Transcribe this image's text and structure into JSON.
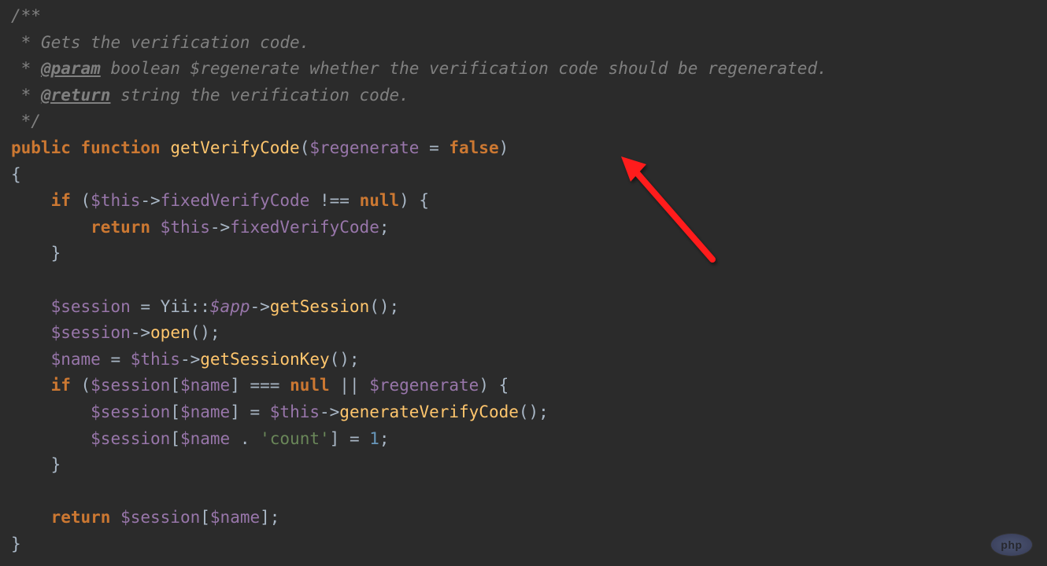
{
  "code": {
    "line1_comment_open": "/**",
    "line2_prefix": " * ",
    "line2_text": "Gets the verification code.",
    "line3_prefix": " * ",
    "line3_tag": "@param",
    "line3_text": " boolean $regenerate whether the verification code should be regenerated.",
    "line4_prefix": " * ",
    "line4_tag": "@return",
    "line4_text": " string the verification code.",
    "line5_comment_close": " */",
    "line6_public": "public",
    "line6_function": "function",
    "line6_funcname": "getVerifyCode",
    "line6_open_paren": "(",
    "line6_param": "$regenerate",
    "line6_eq": " = ",
    "line6_false": "false",
    "line6_close_paren": ")",
    "line7_brace": "{",
    "line8_if": "if",
    "line8_open": " (",
    "line8_this": "$this",
    "line8_arrow": "->",
    "line8_prop": "fixedVerifyCode",
    "line8_neq": " !== ",
    "line8_null": "null",
    "line8_close": ") {",
    "line9_return": "return",
    "line9_this": "$this",
    "line9_arrow": "->",
    "line9_prop": "fixedVerifyCode",
    "line9_semi": ";",
    "line10_brace": "}",
    "line12_var": "$session",
    "line12_eq": " = ",
    "line12_class": "Yii",
    "line12_scope": "::",
    "line12_static": "$app",
    "line12_arrow": "->",
    "line12_method": "getSession",
    "line12_call": "();",
    "line13_var": "$session",
    "line13_arrow": "->",
    "line13_method": "open",
    "line13_call": "();",
    "line14_var": "$name",
    "line14_eq": " = ",
    "line14_this": "$this",
    "line14_arrow": "->",
    "line14_method": "getSessionKey",
    "line14_call": "();",
    "line15_if": "if",
    "line15_open": " (",
    "line15_session": "$session",
    "line15_ob": "[",
    "line15_name": "$name",
    "line15_cb": "]",
    "line15_eqeq": " === ",
    "line15_null": "null",
    "line15_or": " || ",
    "line15_regen": "$regenerate",
    "line15_close": ") {",
    "line16_session": "$session",
    "line16_ob": "[",
    "line16_name": "$name",
    "line16_cb": "]",
    "line16_eq": " = ",
    "line16_this": "$this",
    "line16_arrow": "->",
    "line16_method": "generateVerifyCode",
    "line16_call": "();",
    "line17_session": "$session",
    "line17_ob": "[",
    "line17_name": "$name",
    "line17_concat": " . ",
    "line17_str": "'count'",
    "line17_cb": "]",
    "line17_eq": " = ",
    "line17_num": "1",
    "line17_semi": ";",
    "line18_brace": "}",
    "line20_return": "return",
    "line20_session": "$session",
    "line20_ob": "[",
    "line20_name": "$name",
    "line20_cb": "]",
    "line20_semi": ";",
    "line21_brace": "}"
  },
  "watermark": {
    "logo": "php",
    "suffix": ""
  }
}
